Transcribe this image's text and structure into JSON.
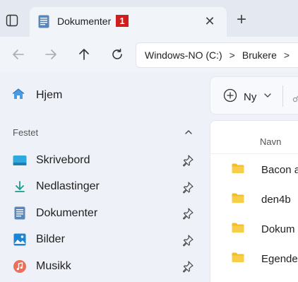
{
  "tab": {
    "title": "Dokumenter",
    "badge": "1",
    "close_glyph": "✕",
    "new_tab_glyph": "+"
  },
  "address": {
    "crumbs": [
      "Windows-NO (C:)",
      "Brukere"
    ],
    "separator": ">"
  },
  "sidebar": {
    "home": {
      "label": "Hjem",
      "icon": "home-icon"
    },
    "section_label": "Festet",
    "pinned": [
      {
        "label": "Skrivebord",
        "icon": "desktop-icon"
      },
      {
        "label": "Nedlastinger",
        "icon": "download-icon"
      },
      {
        "label": "Dokumenter",
        "icon": "documents-icon"
      },
      {
        "label": "Bilder",
        "icon": "pictures-icon"
      },
      {
        "label": "Musikk",
        "icon": "music-icon"
      }
    ]
  },
  "commandbar": {
    "new_label": "Ny"
  },
  "files": {
    "column_name": "Navn",
    "items": [
      "Bacon a",
      "den4b",
      "Dokum",
      "Egende"
    ]
  },
  "colors": {
    "accent": "#0067c0",
    "folder": "#f2bd2a",
    "badge": "#d01d1d"
  }
}
